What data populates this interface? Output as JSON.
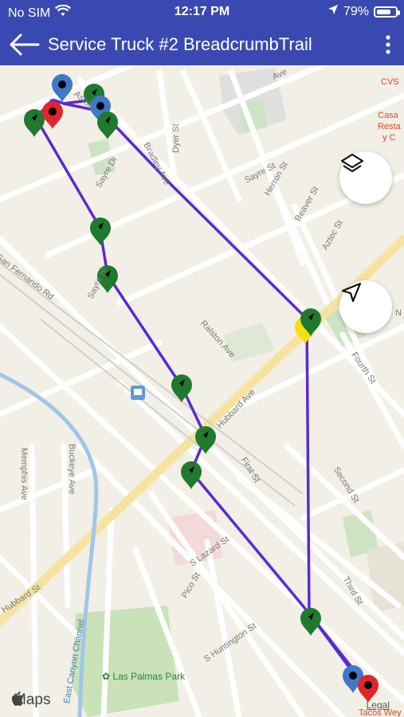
{
  "status_bar": {
    "carrier": "No SIM",
    "time": "12:17 PM",
    "battery": "79%",
    "battery_level": 0.79
  },
  "app_bar": {
    "title": "Service Truck #2 BreadcrumbTrail"
  },
  "map": {
    "streets": [
      "Sayre St",
      "Sayre Dr",
      "Dyer St",
      "Herron St",
      "Beaver St",
      "Aztec St",
      "San Fernando Rd",
      "Ralston Ave",
      "Hubbard Ave",
      "Fourth St",
      "First St",
      "Second St",
      "Memphis Ave",
      "Buckeye Ave",
      "S Lazard St",
      "Pico St",
      "S Huntington St",
      "Third St",
      "Hubbard St",
      "East Canyon Channel",
      "Bradley Ave",
      "Ave",
      "Aston",
      "N"
    ],
    "poi": {
      "park": "Las Palmas Park",
      "store": "CVS",
      "restaurant": "Casa",
      "restaurant_2": "Resta",
      "restaurant_3": "y C",
      "tacos": "Tacos Wey"
    },
    "attribution": "Maps",
    "legal": "Legal"
  },
  "colors": {
    "route": "#5a2bd1",
    "header": "#3a49b1",
    "pin_green": "#1f7a2e",
    "pin_red": "#e0262c",
    "pin_blue": "#3f78c8",
    "pin_yellow": "#f2e10a"
  }
}
